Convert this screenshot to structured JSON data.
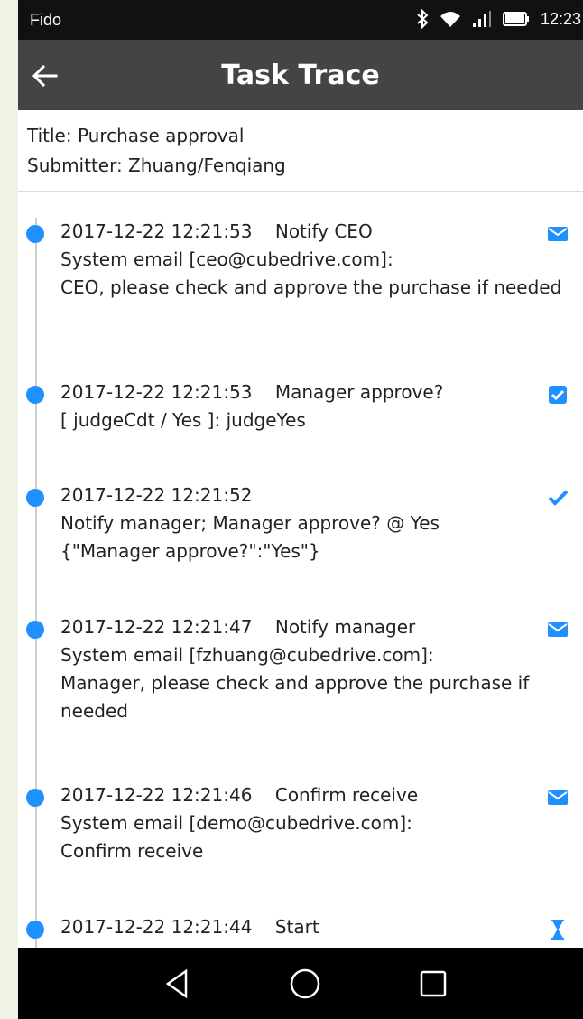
{
  "status_bar": {
    "carrier": "Fido",
    "time": "12:23",
    "icons": [
      "bluetooth-icon",
      "wifi-icon",
      "signal-icon",
      "battery-icon"
    ]
  },
  "header": {
    "title": "Task Trace",
    "back_icon": "arrow-left-icon"
  },
  "task_info": {
    "title_line": "Title:  Purchase approval",
    "submitter_line": "Submitter:  Zhuang/Fenqiang"
  },
  "colors": {
    "accent": "#1e90ff",
    "app_bar": "#444444",
    "status_bar": "#111111"
  },
  "trace": [
    {
      "timestamp": "2017-12-22 12:21:53",
      "action": "Notify CEO",
      "icon": "email-icon",
      "lines": [
        "System email [ceo@cubedrive.com]:",
        "CEO, please check and approve the purchase if needed"
      ]
    },
    {
      "timestamp": "2017-12-22 12:21:53",
      "action": "Manager approve?",
      "icon": "checked-box-icon",
      "lines": [
        "[ judgeCdt / Yes ]: judgeYes"
      ]
    },
    {
      "timestamp": "2017-12-22 12:21:52",
      "action": "",
      "icon": "checkmark-icon",
      "lines": [
        "Notify manager; Manager approve? @ Yes",
        "{\"Manager approve?\":\"Yes\"}"
      ]
    },
    {
      "timestamp": "2017-12-22 12:21:47",
      "action": "Notify manager",
      "icon": "email-icon",
      "lines": [
        "System email [fzhuang@cubedrive.com]:",
        "Manager, please check and approve the purchase if needed"
      ]
    },
    {
      "timestamp": "2017-12-22 12:21:46",
      "action": "Confirm receive",
      "icon": "email-icon",
      "lines": [
        "System email [demo@cubedrive.com]:",
        "Confirm receive"
      ]
    },
    {
      "timestamp": "2017-12-22 12:21:44",
      "action": "Start",
      "icon": "hourglass-icon",
      "lines": []
    }
  ],
  "nav_bar": {
    "buttons": [
      "back-triangle-icon",
      "home-circle-icon",
      "recents-square-icon"
    ]
  }
}
